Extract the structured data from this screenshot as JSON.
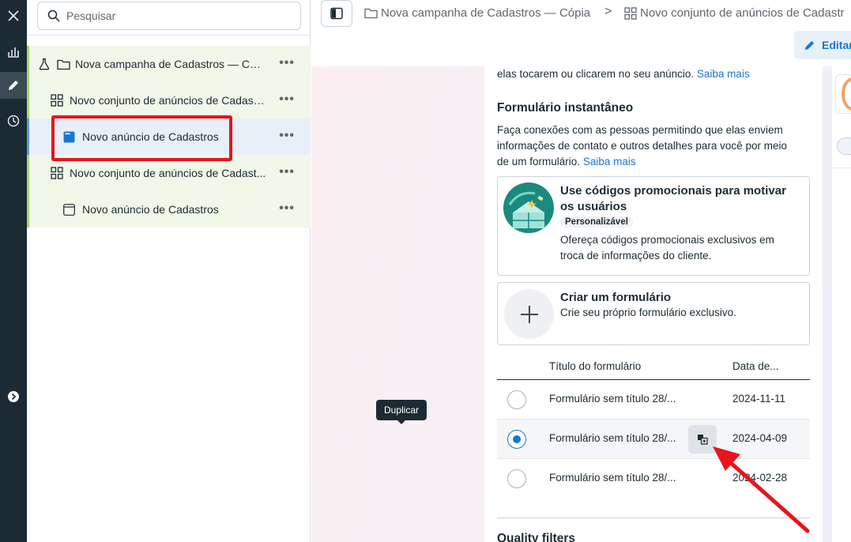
{
  "rail": {
    "icons": [
      "close-icon",
      "chart-icon",
      "pencil-icon",
      "clock-icon",
      "expand-icon"
    ]
  },
  "tree": {
    "search_placeholder": "Pesquisar",
    "items": [
      {
        "label": "Nova campanha de Cadastros — Có...",
        "icon": "flask-folder-icon",
        "level": "campaign"
      },
      {
        "label": "Novo conjunto de anúncios de Cadastr...",
        "icon": "grid-icon",
        "level": "adset"
      },
      {
        "label": "Novo anúncio de Cadastros",
        "icon": "ad-icon",
        "level": "ad",
        "selected": true
      },
      {
        "label": "Novo conjunto de anúncios de Cadast...",
        "icon": "grid-icon",
        "level": "adset"
      },
      {
        "label": "Novo anúncio de Cadastros",
        "icon": "ad-icon",
        "level": "ad"
      }
    ],
    "more": "•••"
  },
  "topbar": {
    "crumb1": "Nova campanha de Cadastros — Cópia",
    "separator": ">",
    "crumb2": "Novo conjunto de anúncios de Cadastr",
    "edit_label": "Editar"
  },
  "content": {
    "intro_text": "elas tocarem ou clicarem no seu anúncio.",
    "saiba_mais": "Saiba mais",
    "section_title": "Formulário instantâneo",
    "section_desc_1": "Faça conexões com as pessoas permitindo que elas enviem",
    "section_desc_2": "informações de contato e outros detalhes para você por meio",
    "section_desc_3": "de um formulário.",
    "option1": {
      "title_1": "Use códigos promocionais para motivar",
      "title_2": "os usuários",
      "badge": "Personalizável",
      "desc_1": "Ofereça códigos promocionais exclusivos em",
      "desc_2": "troca de informações do cliente."
    },
    "option2": {
      "title": "Criar um formulário",
      "desc": "Crie seu próprio formulário exclusivo."
    },
    "table": {
      "col_title": "Título do formulário",
      "col_date": "Data de...",
      "rows": [
        {
          "name": "Formulário sem título 28/...",
          "date": "2024-11-11",
          "selected": false
        },
        {
          "name": "Formulário sem título 28/...",
          "date": "2024-04-09",
          "selected": true
        },
        {
          "name": "Formulário sem título 28/...",
          "date": "2024-02-28",
          "selected": false
        }
      ]
    },
    "tooltip": "Duplicar",
    "quality_filters": "Quality filters"
  },
  "colors": {
    "rail": "#1c2b33",
    "accent": "#1877d2",
    "highlight": "#e8141b",
    "arrow": "#e8141b"
  }
}
